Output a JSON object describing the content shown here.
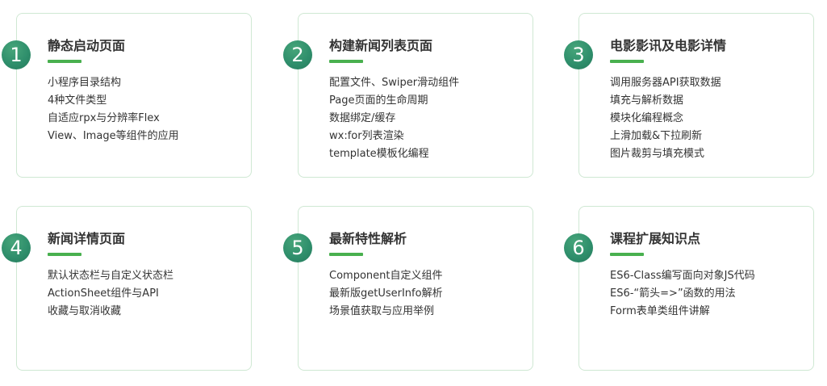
{
  "cards": [
    {
      "number": "1",
      "title": "静态启动页面",
      "items": [
        "小程序目录结构",
        "4种文件类型",
        "自适应rpx与分辨率Flex",
        "View、Image等组件的应用"
      ]
    },
    {
      "number": "2",
      "title": "构建新闻列表页面",
      "items": [
        "配置文件、Swiper滑动组件",
        "Page页面的生命周期",
        "数据绑定/缓存",
        "wx:for列表渲染",
        "template模板化编程"
      ]
    },
    {
      "number": "3",
      "title": "电影影讯及电影详情",
      "items": [
        "调用服务器API获取数据",
        "填充与解析数据",
        "模块化编程概念",
        "上滑加载&下拉刷新",
        "图片裁剪与填充模式"
      ]
    },
    {
      "number": "4",
      "title": "新闻详情页面",
      "items": [
        "默认状态栏与自定义状态栏",
        "ActionSheet组件与API",
        "收藏与取消收藏"
      ]
    },
    {
      "number": "5",
      "title": "最新特性解析",
      "items": [
        "Component自定义组件",
        "最新版getUserInfo解析",
        "场景值获取与应用举例"
      ]
    },
    {
      "number": "6",
      "title": "课程扩展知识点",
      "items": [
        "ES6-Class编写面向对象JS代码",
        "ES6-“箭头=>”函数的用法",
        "Form表单类组件讲解"
      ]
    }
  ],
  "colors": {
    "accent_green": "#49b04f",
    "badge_green": "#2f8f6c",
    "card_border": "#cfe8d3"
  }
}
